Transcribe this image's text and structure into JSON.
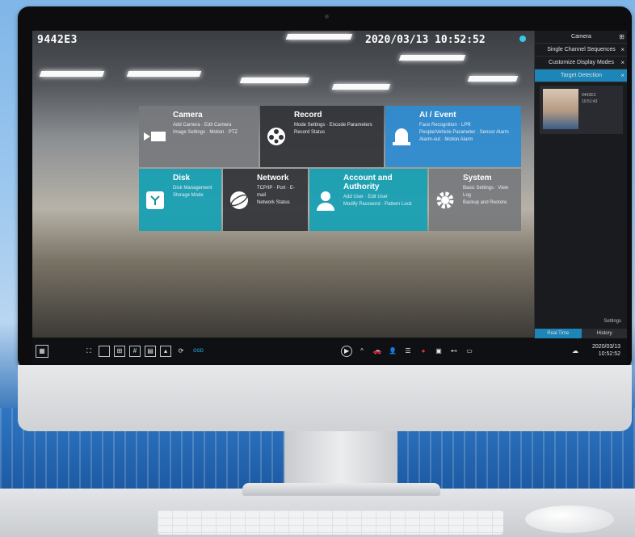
{
  "osd": {
    "channel_name": "9442E3",
    "datetime": "2020/03/13  10:52:52",
    "osd_button": "OSD"
  },
  "menu": {
    "camera": {
      "title": "Camera",
      "line1": "Add Camera · Edit Camera",
      "line2": "Image Settings · Motion · PTZ"
    },
    "record": {
      "title": "Record",
      "line1": "Mode Settings · Encode Parameters",
      "line2": "Record Status"
    },
    "ai_event": {
      "title": "AI / Event",
      "line1": "Face Recognition · LPR",
      "line2": "People/Vehicle Parameter · Sensor Alarm",
      "line3": "Alarm-out · Motion Alarm"
    },
    "disk": {
      "title": "Disk",
      "line1": "Disk Management",
      "line2": "Storage Mode"
    },
    "network": {
      "title": "Network",
      "line1": "TCP/IP · Port · E-mail",
      "line2": "Network Status"
    },
    "account": {
      "title": "Account and Authority",
      "line1": "Add User · Edit User",
      "line2": "Modify Password · Pattern Lock"
    },
    "system": {
      "title": "System",
      "line1": "Basic Settings · View Log",
      "line2": "Backup and Restore"
    }
  },
  "panel": {
    "rows": [
      {
        "label": "Camera",
        "close": "⊞"
      },
      {
        "label": "Single Channel Sequences",
        "close": "×"
      },
      {
        "label": "Customize Display Modes",
        "close": "×"
      },
      {
        "label": "Target Detection",
        "close": "×"
      }
    ],
    "face_card": {
      "line1": "9442E3",
      "line2": "10:51:43"
    },
    "settings": "Settings",
    "tab_realtime": "Real Time",
    "tab_history": "History"
  },
  "status": {
    "date": "2020/03/13",
    "time": "10:52:52"
  }
}
